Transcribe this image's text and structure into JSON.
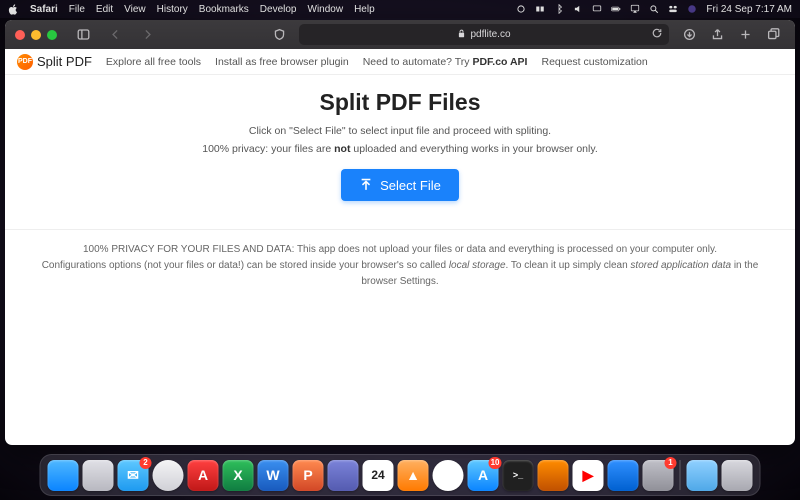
{
  "menubar": {
    "app": "Safari",
    "items": [
      "File",
      "Edit",
      "View",
      "History",
      "Bookmarks",
      "Develop",
      "Window",
      "Help"
    ],
    "clock": "Fri 24 Sep  7:17 AM"
  },
  "browser": {
    "url": "pdflite.co"
  },
  "site": {
    "logo_badge": "PDF",
    "logo_text": "Split PDF",
    "nav": {
      "explore": "Explore all free tools",
      "install": "Install as free browser plugin",
      "automate_prefix": "Need to automate? Try ",
      "automate_bold": "PDF.co API",
      "request": "Request customization"
    }
  },
  "hero": {
    "title": "Split PDF Files",
    "line1": "Click on \"Select File\" to select input file and proceed with spliting.",
    "line2_a": "100% privacy: your files are ",
    "line2_bold": "not",
    "line2_b": " uploaded and everything works in your browser only.",
    "button": "Select File"
  },
  "footer_privacy": {
    "line1": "100% PRIVACY FOR YOUR FILES AND DATA: This app does not upload your files or data and everything is processed on your computer only.",
    "line2_a": "Configurations options (not your files or data!) can be stored inside your browser's so called ",
    "line2_i1": "local storage",
    "line2_b": ". To clean it up simply clean ",
    "line2_i2": "stored application data",
    "line2_c": " in the browser Settings."
  },
  "dock": {
    "items": [
      {
        "name": "finder",
        "bg": "linear-gradient(#4fb8ff,#0a84ff)",
        "glyph": "",
        "badge": null
      },
      {
        "name": "launchpad",
        "bg": "linear-gradient(#e0e0e6,#b8b8c0)",
        "glyph": "",
        "badge": null
      },
      {
        "name": "mail",
        "bg": "linear-gradient(#5ec8ff,#1e9af0)",
        "glyph": "✉",
        "badge": "2"
      },
      {
        "name": "safari",
        "bg": "linear-gradient(#f4f4f6,#d0d0d6)",
        "glyph": "",
        "badge": null,
        "round": true
      },
      {
        "name": "acrobat",
        "bg": "linear-gradient(#ff4040,#c01818)",
        "glyph": "A",
        "badge": null
      },
      {
        "name": "excel",
        "bg": "linear-gradient(#2fbf5b,#107c41)",
        "glyph": "X",
        "badge": null
      },
      {
        "name": "word",
        "bg": "linear-gradient(#3a8ff0,#185abd)",
        "glyph": "W",
        "badge": null
      },
      {
        "name": "powerpoint",
        "bg": "linear-gradient(#ff8a50,#d24726)",
        "glyph": "P",
        "badge": null
      },
      {
        "name": "teams",
        "bg": "linear-gradient(#7b83d9,#545bb0)",
        "glyph": "",
        "badge": null
      },
      {
        "name": "calendar",
        "bg": "#ffffff",
        "glyph": "24",
        "badge": null
      },
      {
        "name": "vlc",
        "bg": "linear-gradient(#ffb060,#ff7a00)",
        "glyph": "▲",
        "badge": null
      },
      {
        "name": "chrome",
        "bg": "#ffffff",
        "glyph": "",
        "badge": null,
        "round": true
      },
      {
        "name": "appstore",
        "bg": "linear-gradient(#5ec8ff,#0a84ff)",
        "glyph": "A",
        "badge": "10"
      },
      {
        "name": "terminal",
        "bg": "#202020",
        "glyph": ">_",
        "badge": null
      },
      {
        "name": "matlab",
        "bg": "linear-gradient(#ff8c00,#c05000)",
        "glyph": "",
        "badge": null
      },
      {
        "name": "youtube",
        "bg": "#ffffff",
        "glyph": "▶",
        "badge": null
      },
      {
        "name": "box",
        "bg": "linear-gradient(#3090ff,#0060d0)",
        "glyph": "",
        "badge": null
      },
      {
        "name": "app1",
        "bg": "linear-gradient(#c0c0c8,#909098)",
        "glyph": "",
        "badge": "1"
      },
      {
        "name": "folder",
        "bg": "linear-gradient(#8fd0ff,#4fa8e8)",
        "glyph": "",
        "badge": null
      },
      {
        "name": "trash",
        "bg": "linear-gradient(#d8d8de,#a8a8b0)",
        "glyph": "",
        "badge": null
      }
    ]
  }
}
